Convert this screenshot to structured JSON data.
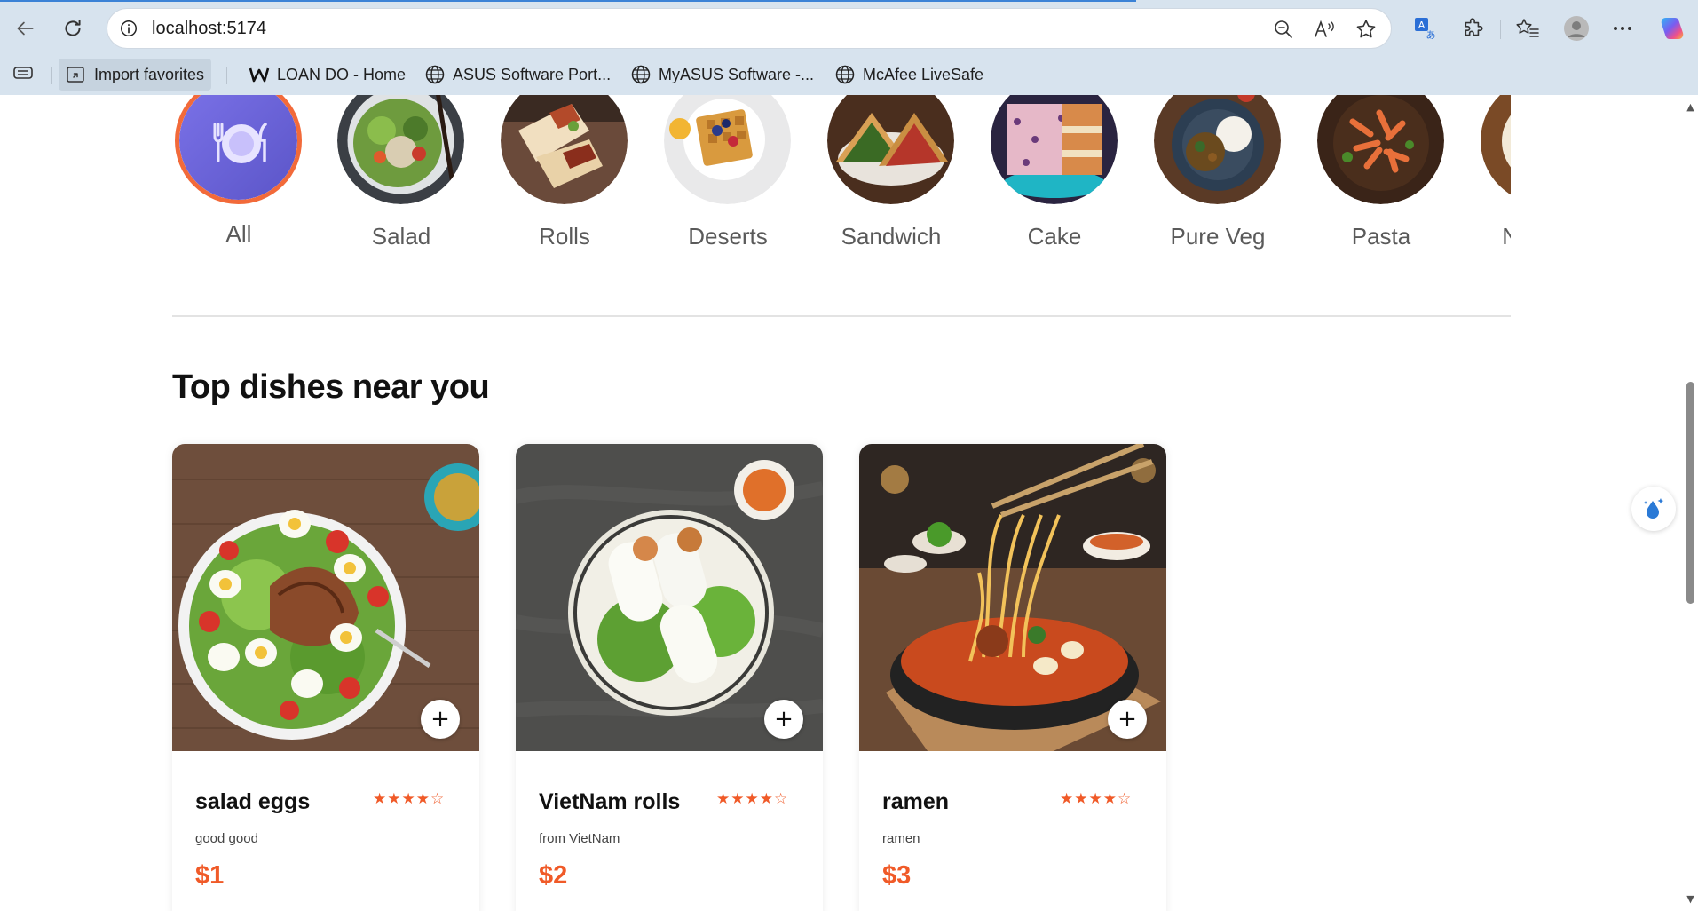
{
  "browser": {
    "url": "localhost:5174",
    "favorites": [
      {
        "label": "Import favorites",
        "icon": "import-favorites-icon"
      },
      {
        "label": "LOAN DO - Home",
        "icon": "w-logo-icon"
      },
      {
        "label": "ASUS Software Port...",
        "icon": "globe-icon"
      },
      {
        "label": "MyASUS Software -...",
        "icon": "globe-icon"
      },
      {
        "label": "McAfee LiveSafe",
        "icon": "globe-icon"
      }
    ]
  },
  "menu": {
    "items": [
      {
        "label": "All",
        "active": true
      },
      {
        "label": "Salad"
      },
      {
        "label": "Rolls"
      },
      {
        "label": "Deserts"
      },
      {
        "label": "Sandwich"
      },
      {
        "label": "Cake"
      },
      {
        "label": "Pure Veg"
      },
      {
        "label": "Pasta"
      },
      {
        "label": "Noodles"
      }
    ]
  },
  "section": {
    "title": "Top dishes near you"
  },
  "dishes": [
    {
      "name": "salad eggs",
      "description": "good good",
      "price": "$1",
      "rating": 4,
      "stars": "★★★★☆",
      "add_label": "+"
    },
    {
      "name": "VietNam rolls",
      "description": "from VietNam",
      "price": "$2",
      "rating": 4,
      "stars": "★★★★☆",
      "add_label": "+"
    },
    {
      "name": "ramen",
      "description": "ramen",
      "price": "$3",
      "rating": 4,
      "stars": "★★★★☆",
      "add_label": "+"
    }
  ],
  "colors": {
    "accent": "#f05a28",
    "active_ring": "#f26a3a",
    "all_icon_bg": "#6a64d8"
  }
}
